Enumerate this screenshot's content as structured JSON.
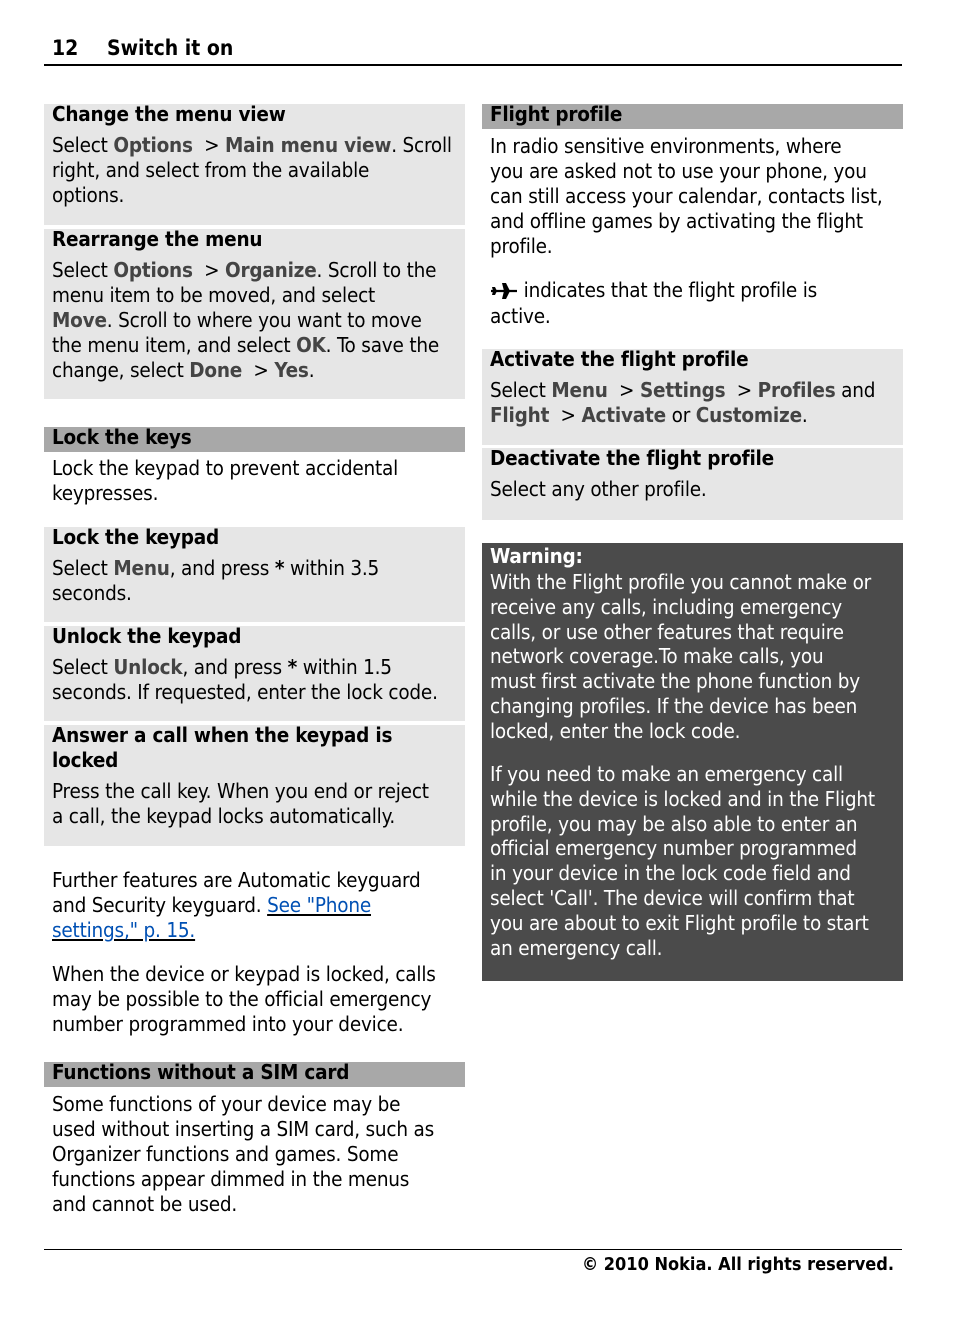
{
  "header": {
    "page_number": "12",
    "title": "Switch it on"
  },
  "footer": {
    "copyright": "© 2010 Nokia. All rights reserved."
  },
  "left": {
    "change_menu_view": {
      "title": "Change the menu view",
      "l1a": "Select ",
      "l1b": "Options",
      "l1c": "  > ",
      "l1d": "Main menu view",
      "l1e": ". Scroll",
      "l2": "right, and select from the available",
      "l3": "options."
    },
    "rearrange_menu": {
      "title": "Rearrange the menu",
      "l1a": "Select ",
      "l1b": "Options",
      "l1c": "  > ",
      "l1d": "Organize",
      "l1e": ". Scroll to the",
      "l2": "menu item to be moved, and select",
      "l3a": "Move",
      "l3b": ". Scroll to where you want to move",
      "l4a": "the menu item, and select ",
      "l4b": "OK",
      "l4c": ". To save the",
      "l5a": "change, select ",
      "l5b": "Done",
      "l5c": "  > ",
      "l5d": "Yes",
      "l5e": "."
    },
    "lock_keys": {
      "title": "Lock the keys",
      "l1": "Lock the keypad to prevent accidental",
      "l2": "keypresses."
    },
    "lock_keypad": {
      "title": "Lock the keypad",
      "l1a": "Select ",
      "l1b": "Menu",
      "l1c": ", and press ",
      "l1d": "*",
      "l1e": " within 3.5",
      "l2": "seconds."
    },
    "unlock_keypad": {
      "title": "Unlock the keypad",
      "l1a": "Select ",
      "l1b": "Unlock",
      "l1c": ", and press ",
      "l1d": "*",
      "l1e": " within 1.5",
      "l2": "seconds. If requested, enter the lock code."
    },
    "answer_call": {
      "title1": "Answer a call when the keypad is",
      "title2": "locked",
      "l1": "Press the call key. When you end or reject",
      "l2": "a call, the keypad locks automatically."
    },
    "further": {
      "l1": "Further features are Automatic keyguard",
      "l2a": "and Security keyguard. ",
      "l2b": "See \"Phone",
      "l3": "settings,\" p. 15."
    },
    "emergency_note": {
      "l1": "When the device or keypad is locked, calls",
      "l2": "may be possible to the official emergency",
      "l3": "number programmed into your device."
    },
    "no_sim": {
      "title": "Functions without a SIM card",
      "l1": "Some functions of your device may be",
      "l2": "used without inserting a SIM card, such as",
      "l3": "Organizer functions and games. Some",
      "l4": "functions appear dimmed in the menus",
      "l5": "and cannot be used."
    }
  },
  "right": {
    "flight_profile": {
      "title": "Flight profile",
      "l1": "In radio sensitive environments, where",
      "l2": "you are asked not to use your phone, you",
      "l3": "can still access your calendar, contacts list,",
      "l4": "and offline games by activating the flight",
      "l5": "profile.",
      "icon": "airplane-icon",
      "i1": " indicates that the flight profile is",
      "i2": "active."
    },
    "activate": {
      "title": "Activate the flight profile",
      "l1a": "Select ",
      "l1b": "Menu",
      "l1c": "  > ",
      "l1d": "Settings",
      "l1e": "  > ",
      "l1f": "Profiles",
      "l1g": " and",
      "l2a": "Flight",
      "l2b": "  > ",
      "l2c": "Activate",
      "l2d": " or ",
      "l2e": "Customize",
      "l2f": "."
    },
    "deactivate": {
      "title": "Deactivate the flight profile",
      "l1": "Select any other profile."
    },
    "warning": {
      "title": "Warning:",
      "p1": [
        "With the Flight profile you cannot make or",
        "receive any calls, including emergency",
        "calls, or use other features that require",
        "network coverage.To make calls, you",
        "must first activate the phone function by",
        "changing profiles. If the device has been",
        "locked, enter the lock code."
      ],
      "p2": [
        "If you need to make an emergency call",
        "while the device is locked and in the Flight",
        "profile, you may be also able to enter an",
        "official emergency number programmed",
        "in your device in the lock code field and",
        "select 'Call'. The device will confirm that",
        "you are about to exit Flight profile to start",
        "an emergency call."
      ]
    }
  }
}
